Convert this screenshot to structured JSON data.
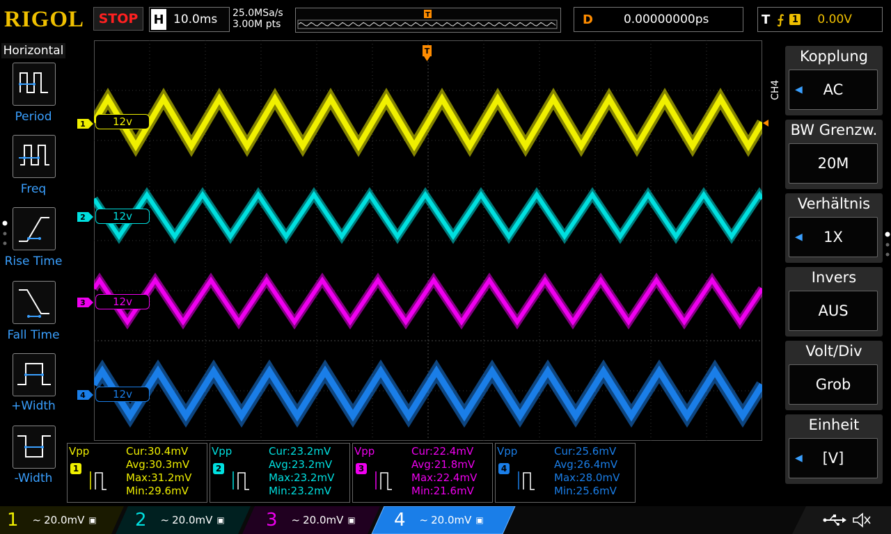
{
  "topbar": {
    "logo": "RIGOL",
    "run_state": "STOP",
    "h_label": "H",
    "timebase": "10.0ms",
    "sample_rate": "25.0MSa/s",
    "mem_depth": "3.00M pts",
    "delay_label": "D",
    "delay_value": "0.00000000ps",
    "trig_label": "T",
    "trig_source": "1",
    "trig_level": "0.00V"
  },
  "left_menu": {
    "title": "Horizontal",
    "items": [
      {
        "label": "Period"
      },
      {
        "label": "Freq"
      },
      {
        "label": "Rise Time"
      },
      {
        "label": "Fall Time"
      },
      {
        "label": "+Width"
      },
      {
        "label": "-Width"
      }
    ]
  },
  "right_menu": {
    "channel_tag": "CH4",
    "items": [
      {
        "title": "Kopplung",
        "value": "AC",
        "arrow": true
      },
      {
        "title": "BW Grenzw.",
        "value": "20M",
        "arrow": false
      },
      {
        "title": "Verhältnis",
        "value": "1X",
        "arrow": true
      },
      {
        "title": "Invers",
        "value": "AUS",
        "arrow": false
      },
      {
        "title": "Volt/Div",
        "value": "Grob",
        "arrow": false
      },
      {
        "title": "Einheit",
        "value": "[V]",
        "arrow": true
      }
    ]
  },
  "channels": [
    {
      "num": "1",
      "label": "12v",
      "color": "#f0f000",
      "scale": "20.0mV"
    },
    {
      "num": "2",
      "label": "12v",
      "color": "#00e0e0",
      "scale": "20.0mV"
    },
    {
      "num": "3",
      "label": "12v",
      "color": "#f000f0",
      "scale": "20.0mV"
    },
    {
      "num": "4",
      "label": "12v",
      "color": "#1a7ee8",
      "scale": "20.0mV"
    }
  ],
  "measurements": [
    {
      "type": "Vpp",
      "num": "1",
      "cur": "Cur:30.4mV",
      "avg": "Avg:30.3mV",
      "max": "Max:31.2mV",
      "min": "Min:29.6mV",
      "color": "#f0f000"
    },
    {
      "type": "Vpp",
      "num": "2",
      "cur": "Cur:23.2mV",
      "avg": "Avg:23.2mV",
      "max": "Max:23.2mV",
      "min": "Min:23.2mV",
      "color": "#00e0e0"
    },
    {
      "type": "Vpp",
      "num": "3",
      "cur": "Cur:22.4mV",
      "avg": "Avg:21.8mV",
      "max": "Max:22.4mV",
      "min": "Min:21.6mV",
      "color": "#f000f0"
    },
    {
      "type": "Vpp",
      "num": "4",
      "cur": "Cur:25.6mV",
      "avg": "Avg:26.4mV",
      "max": "Max:28.0mV",
      "min": "Min:25.6mV",
      "color": "#1a7ee8"
    }
  ],
  "waveform": {
    "type": "triangle",
    "cycles_on_screen": 12
  },
  "icons": [
    "usb-icon",
    "speaker-mute-icon",
    "trigger-marker-icon",
    "coupling-ac-icon"
  ]
}
